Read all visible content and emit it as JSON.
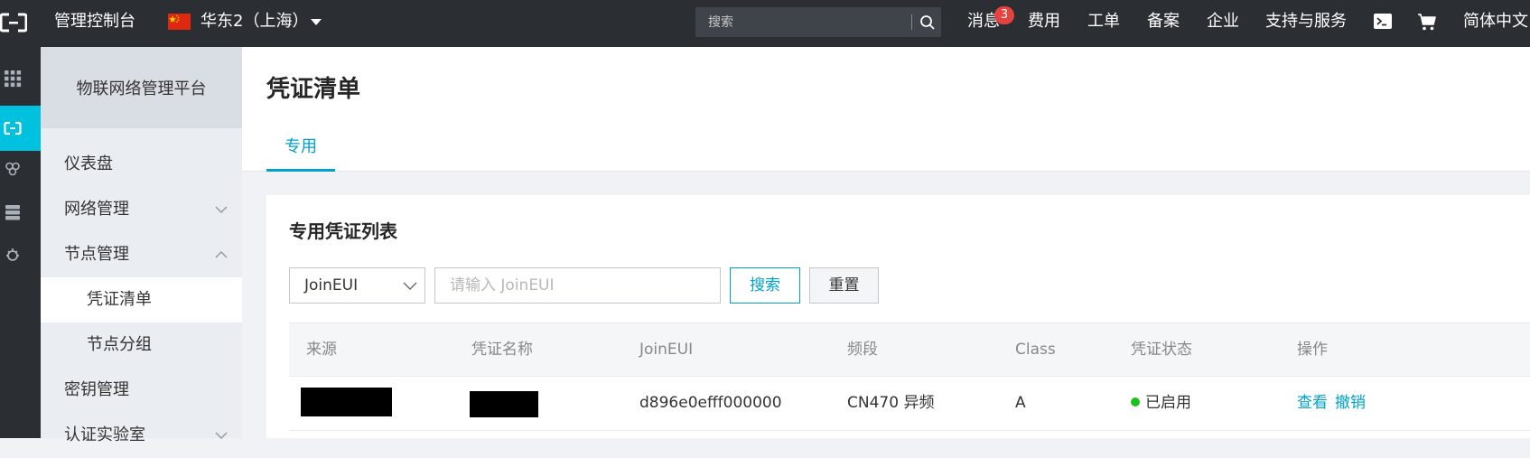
{
  "topbar": {
    "console_title": "管理控制台",
    "region": "华东2（上海）",
    "search_placeholder": "搜索",
    "nav": [
      "消息",
      "费用",
      "工单",
      "备案",
      "企业",
      "支持与服务",
      "简体中文"
    ],
    "message_badge": "3"
  },
  "sidebar": {
    "header": "物联网络管理平台",
    "items": [
      {
        "label": "仪表盘",
        "expand": "none"
      },
      {
        "label": "网络管理",
        "expand": "down"
      },
      {
        "label": "节点管理",
        "expand": "up"
      },
      {
        "label": "凭证清单",
        "sub": true,
        "active": true
      },
      {
        "label": "节点分组",
        "sub": true
      },
      {
        "label": "密钥管理",
        "expand": "none"
      },
      {
        "label": "认证实验室",
        "expand": "down"
      }
    ]
  },
  "main": {
    "page_title": "凭证清单",
    "tab": "专用",
    "card_title": "专用凭证列表",
    "filter": {
      "select_value": "JoinEUI",
      "input_placeholder": "请输入 JoinEUI",
      "search_label": "搜索",
      "reset_label": "重置"
    },
    "table": {
      "columns": [
        "来源",
        "凭证名称",
        "JoinEUI",
        "频段",
        "Class",
        "凭证状态",
        "操作"
      ],
      "rows": [
        {
          "source": "",
          "name": "",
          "joineui": "d896e0efff000000",
          "band": "CN470 异频",
          "class": "A",
          "status": "已启用",
          "actions": [
            "查看",
            "撤销"
          ]
        }
      ]
    }
  },
  "colors": {
    "topbar_bg": "#2b2e33",
    "accent": "#00a2ca",
    "rail_active": "#00c1de",
    "status_enabled": "#1dc11d",
    "badge": "#e64340"
  }
}
